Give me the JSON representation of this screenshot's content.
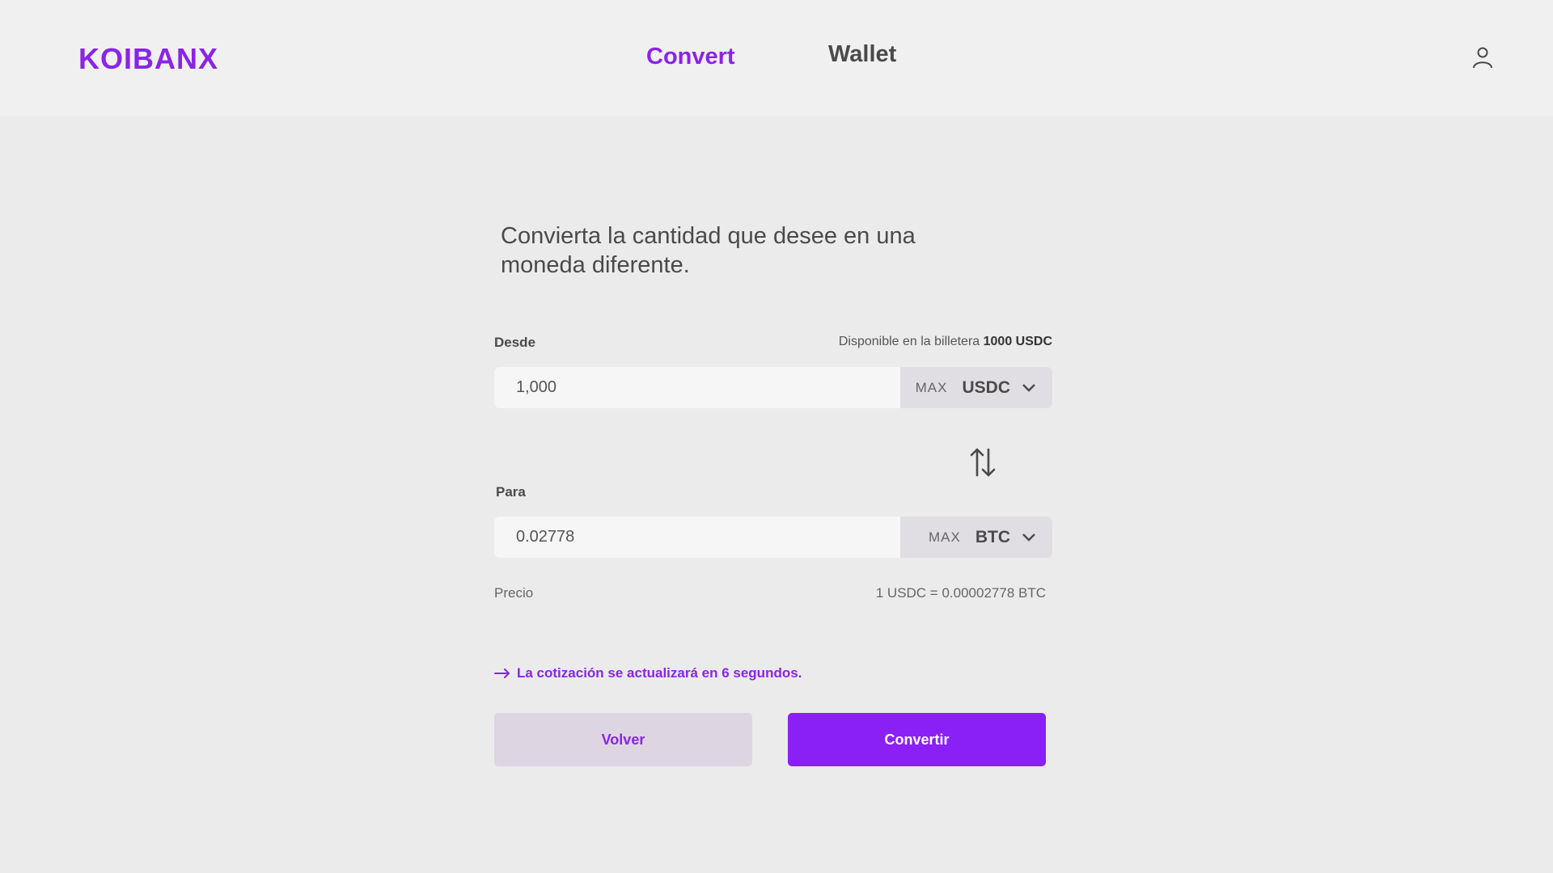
{
  "brand": {
    "name": "KOIBANX",
    "accent": "#8a24e8"
  },
  "nav": {
    "items": [
      {
        "label": "Convert",
        "active": true
      },
      {
        "label": "Wallet",
        "active": false
      }
    ],
    "user_icon": "user-icon"
  },
  "convert": {
    "headline": "Convierta la cantidad que desee en una moneda diferente.",
    "from": {
      "label": "Desde",
      "available_prefix": "Disponible en la billetera",
      "available_amount": "1000 USDC",
      "value": "1,000",
      "max_label": "MAX",
      "currency": "USDC"
    },
    "to": {
      "label": "Para",
      "value": "0.02778",
      "max_label": "MAX",
      "currency": "BTC"
    },
    "swap_icon": "swap-vertical-icon",
    "price": {
      "label": "Precio",
      "value": "1 USDC = 0.00002778 BTC"
    },
    "refresh_notice": "La cotización se actualizará en 6 segundos.",
    "back_button": "Volver",
    "convert_button": "Convertir"
  }
}
